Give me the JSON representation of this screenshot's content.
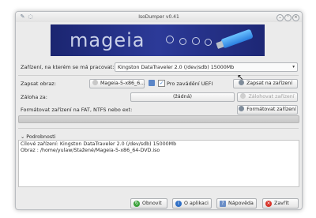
{
  "window": {
    "title": "IsoDumper v0.41"
  },
  "banner": {
    "brand": "mageia"
  },
  "device_row": {
    "label": "Zařízení, na kterém se má pracovat:",
    "selected": "Kingston DataTraveler 2.0 (/dev/sdb) 15000Mb"
  },
  "write_row": {
    "label": "Zapsat obraz:",
    "file_button": "Mageia-5-x86_6...",
    "uefi_checkbox": "Pro zavádění UEFI",
    "uefi_checked": true,
    "write_button": "Zapsat na zařízení"
  },
  "backup_row": {
    "label": "Záloha za:",
    "value": "(žádná)",
    "backup_button": "Zálohovat zařízení"
  },
  "format_row": {
    "label": "Formátovat zařízení na FAT, NTFS nebo ext:",
    "format_button": "Formátovat zařízení"
  },
  "progress": {
    "value": 0
  },
  "details": {
    "header": "Podrobnosti",
    "lines": [
      "Cílové zařízení: Kingston DataTraveler 2.0 (/dev/sdb) 15000Mb",
      "Obraz : /home/yulaw/Stažené/Mageia-5-x86_64-DVD.iso"
    ]
  },
  "buttons": {
    "refresh": "Obnovit",
    "about": "O aplikaci",
    "help": "Nápověda",
    "quit": "Zavřít"
  },
  "colors": {
    "banner": "#26318a",
    "accent": "#3c8bd9",
    "quit": "#d8342a",
    "refresh": "#3aa23a"
  }
}
